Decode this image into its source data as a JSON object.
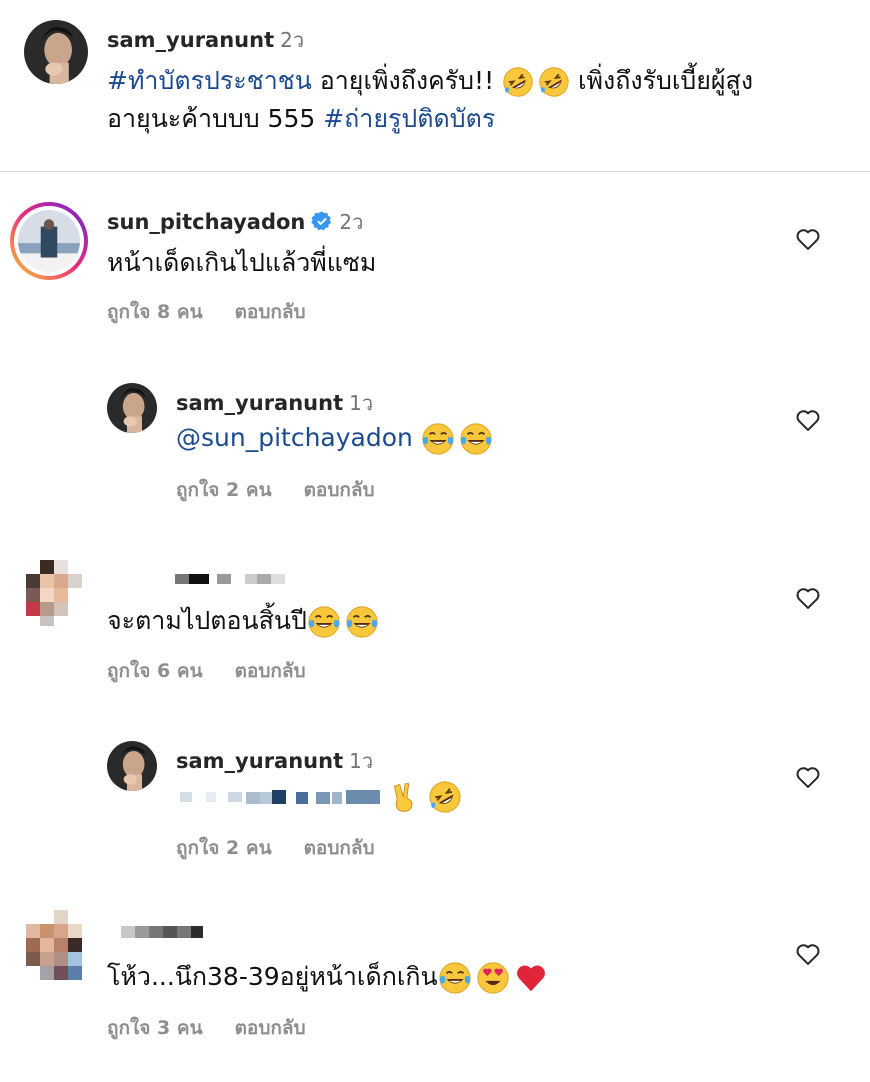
{
  "post": {
    "username": "sam_yuranunt",
    "time": "2ว",
    "hashtag1": "#ทำบัตรประชาชน",
    "line1_text": " อายุเพิ่งถึงครับ!! ",
    "line1_after_emoji": " เพิ่งถึงรับเบี้ยผู้สูง",
    "line2_text": "อายุนะค้าบบบ 555 ",
    "hashtag2": "#ถ่ายรูปติดบัตร"
  },
  "comments": [
    {
      "username": "sun_pitchayadon",
      "time": "2ว",
      "text": "หน้าเด็ดเกินไปแล้วพี่แซม",
      "likes": "ถูกใจ 8 คน",
      "reply": "ตอบกลับ"
    },
    {
      "username": "sam_yuranunt",
      "time": "1ว",
      "mention": "@sun_pitchayadon",
      "likes": "ถูกใจ 2 คน",
      "reply": "ตอบกลับ"
    },
    {
      "text": "จะตามไปตอนสิ้นปี",
      "likes": "ถูกใจ 6 คน",
      "reply": "ตอบกลับ"
    },
    {
      "username": "sam_yuranunt",
      "time": "1ว",
      "likes": "ถูกใจ 2 คน",
      "reply": "ตอบกลับ"
    },
    {
      "text": "โห้ว...นึก38-39อยู่หน้าเด็กเกิน",
      "likes": "ถูกใจ 3 คน",
      "reply": "ตอบกลับ"
    }
  ],
  "icons": {
    "like": "heart-outline-icon",
    "verified": "verified-badge-icon",
    "rofl": "rolling-laughing-emoji",
    "joy": "tears-of-joy-emoji",
    "heart_eyes": "heart-eyes-emoji",
    "red_heart": "red-heart-emoji",
    "victory": "victory-hand-emoji"
  },
  "colors": {
    "hashtag": "#1c4a8f",
    "meta": "#8e8e8e",
    "verified": "#3897f0",
    "story_ring_start": "#f9ce34",
    "story_ring_end": "#ee2a7b"
  }
}
